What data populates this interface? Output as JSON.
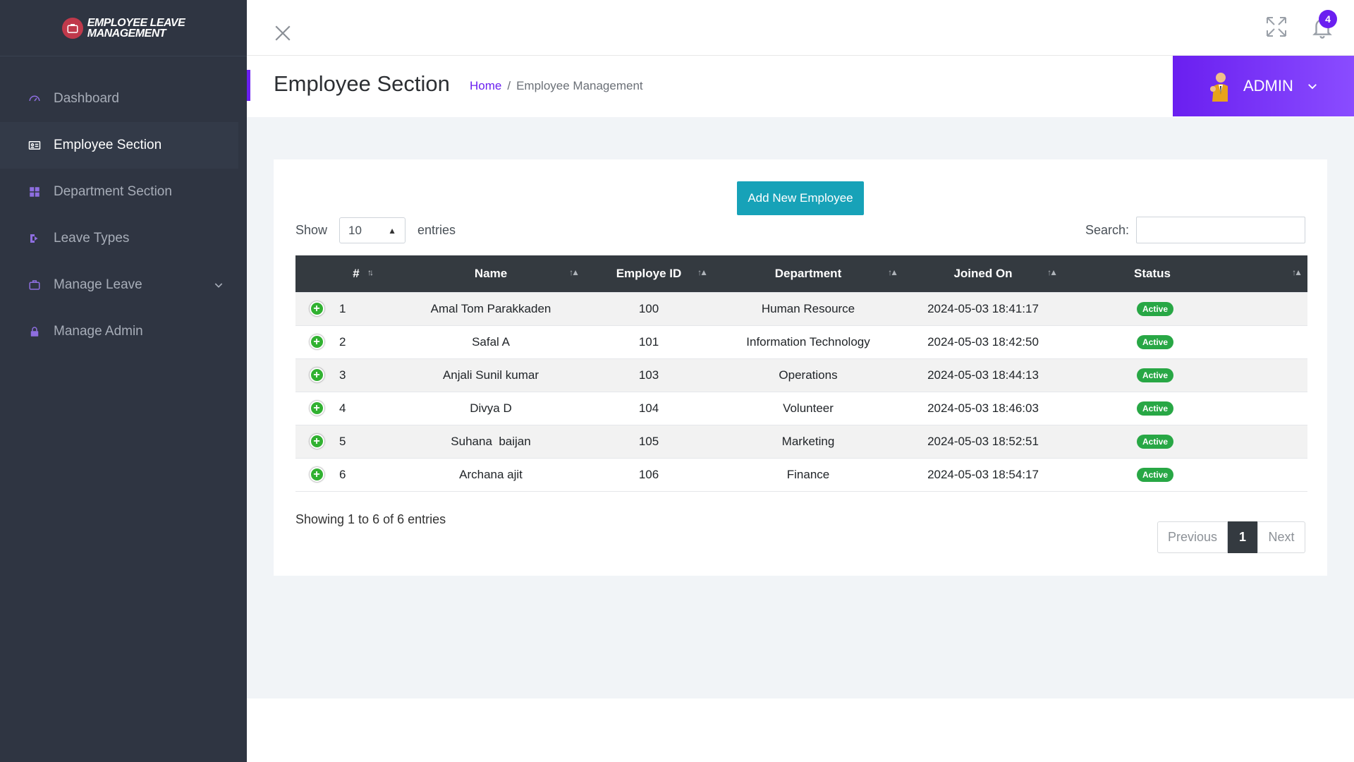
{
  "brand": {
    "line1": "EMPLOYEE LEAVE",
    "line2": "MANAGEMENT"
  },
  "sidebar": {
    "items": [
      {
        "label": "Dashboard",
        "icon": "dashboard-icon"
      },
      {
        "label": "Employee Section",
        "icon": "id-card-icon",
        "active": true
      },
      {
        "label": "Department Section",
        "icon": "grid-icon"
      },
      {
        "label": "Leave Types",
        "icon": "sign-out-icon"
      },
      {
        "label": "Manage Leave",
        "icon": "briefcase-icon",
        "has_submenu": true
      },
      {
        "label": "Manage Admin",
        "icon": "lock-icon"
      }
    ]
  },
  "topbar": {
    "notification_count": "4"
  },
  "page": {
    "title": "Employee Section",
    "breadcrumb": {
      "home": "Home",
      "separator": "/",
      "current": "Employee Management"
    }
  },
  "admin": {
    "label": "ADMIN"
  },
  "actions": {
    "add_employee": "Add New Employee"
  },
  "table_controls": {
    "show_label": "Show",
    "entries_label": "entries",
    "page_length": "10",
    "search_label": "Search:",
    "search_value": ""
  },
  "table": {
    "columns": [
      "#",
      "Name",
      "Employe ID",
      "Department",
      "Joined On",
      "Status"
    ],
    "rows": [
      {
        "num": "1",
        "name": "Amal Tom Parakkaden",
        "id": "100",
        "department": "Human Resource",
        "joined": "2024-05-03 18:41:17",
        "status": "Active"
      },
      {
        "num": "2",
        "name": "Safal A",
        "id": "101",
        "department": "Information Technology",
        "joined": "2024-05-03 18:42:50",
        "status": "Active"
      },
      {
        "num": "3",
        "name": "Anjali Sunil kumar",
        "id": "103",
        "department": "Operations",
        "joined": "2024-05-03 18:44:13",
        "status": "Active"
      },
      {
        "num": "4",
        "name": "Divya D",
        "id": "104",
        "department": "Volunteer",
        "joined": "2024-05-03 18:46:03",
        "status": "Active"
      },
      {
        "num": "5",
        "name": "Suhana  baijan",
        "id": "105",
        "department": "Marketing",
        "joined": "2024-05-03 18:52:51",
        "status": "Active"
      },
      {
        "num": "6",
        "name": "Archana ajit",
        "id": "106",
        "department": "Finance",
        "joined": "2024-05-03 18:54:17",
        "status": "Active"
      }
    ]
  },
  "footer": {
    "info": "Showing 1 to 6 of 6 entries",
    "pagination": {
      "previous": "Previous",
      "current": "1",
      "next": "Next"
    }
  },
  "colors": {
    "accent": "#6a1ff0",
    "sidebar_bg": "#2f3542",
    "button": "#17a2b8",
    "status_active": "#28a745",
    "table_header": "#343a40"
  }
}
